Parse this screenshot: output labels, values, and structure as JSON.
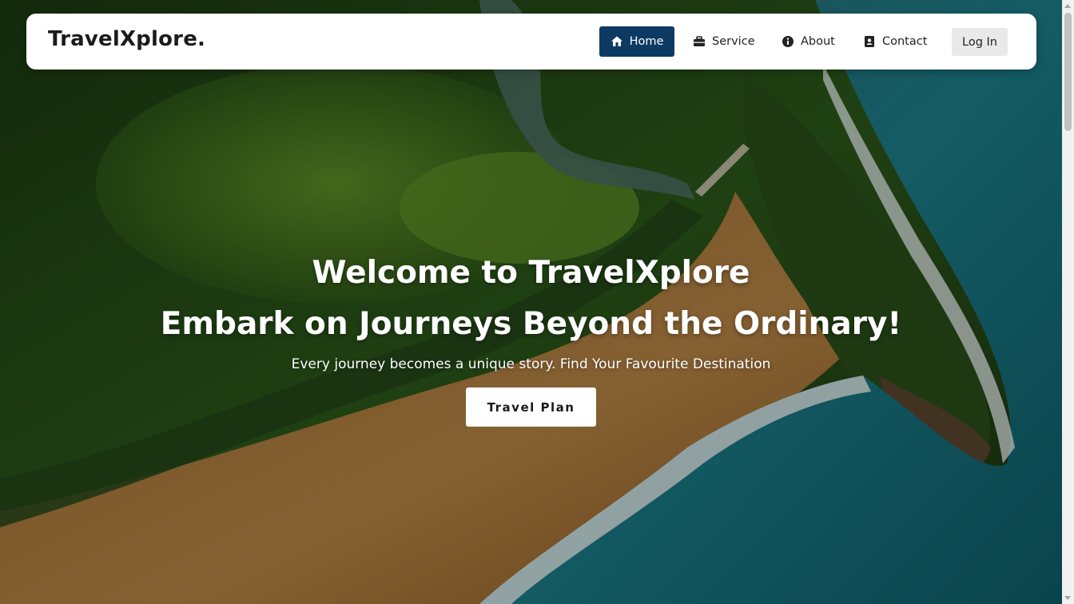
{
  "navbar": {
    "brand": "TravelXplore.",
    "items": [
      {
        "label": "Home",
        "icon": "home-icon",
        "active": true
      },
      {
        "label": "Service",
        "icon": "briefcase-icon",
        "active": false
      },
      {
        "label": "About",
        "icon": "info-icon",
        "active": false
      },
      {
        "label": "Contact",
        "icon": "contact-card-icon",
        "active": false
      }
    ],
    "login_label": "Log In"
  },
  "hero": {
    "title": "Welcome to TravelXplore",
    "subtitle": "Embark on Journeys Beyond the Ordinary!",
    "tagline": "Every journey becomes a unique story. Find Your Favourite Destination",
    "cta_label": "Travel Plan",
    "background": "aerial-coastline-image"
  },
  "colors": {
    "active_nav": "#0d3a63",
    "navbar_bg": "#ffffff",
    "login_bg": "#e9e9e9",
    "hero_text": "#ffffff"
  }
}
